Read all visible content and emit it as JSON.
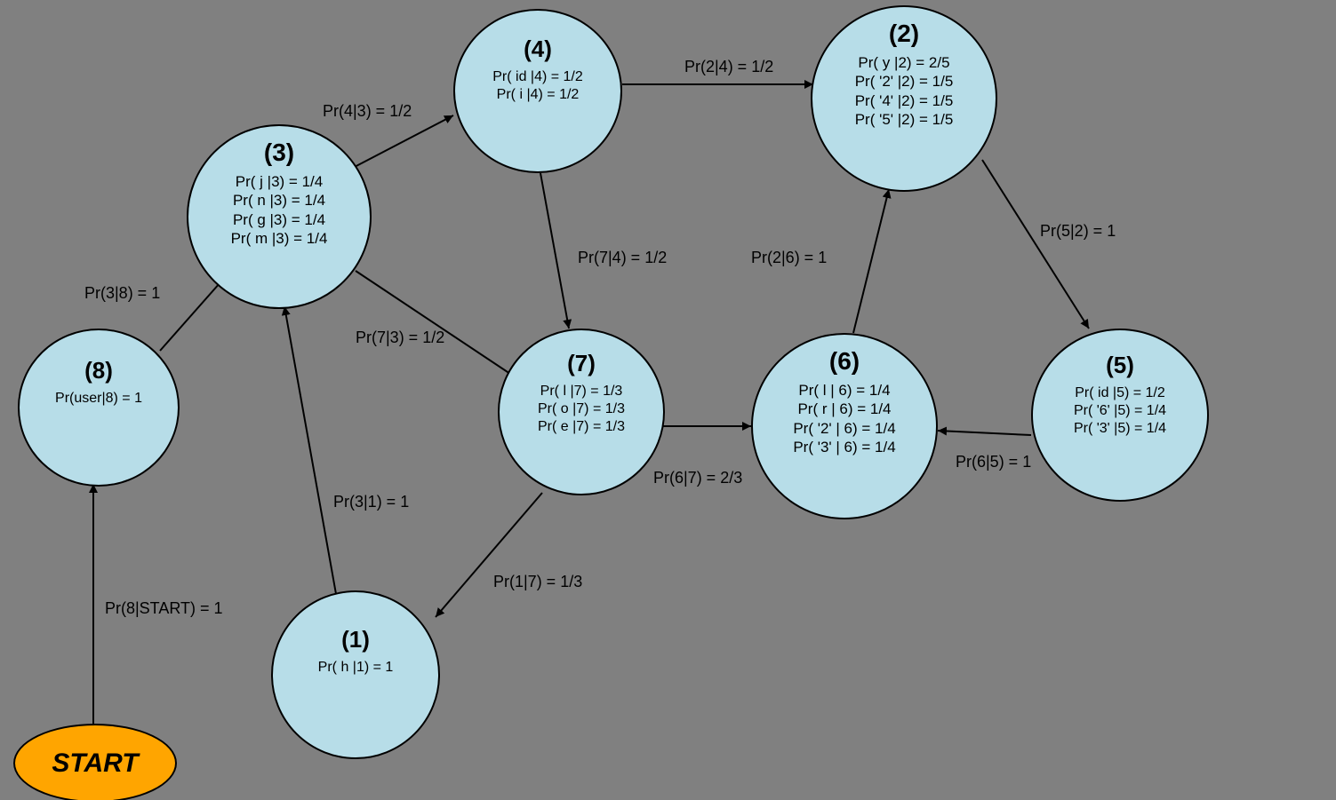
{
  "start": {
    "label": "START"
  },
  "nodes": {
    "n1": {
      "title": "(1)",
      "lines": "Pr( h |1) = 1"
    },
    "n2": {
      "title": "(2)",
      "lines": "Pr( y |2) = 2/5\nPr( '2' |2) = 1/5\nPr( '4' |2) = 1/5\nPr( '5' |2) = 1/5"
    },
    "n3": {
      "title": "(3)",
      "lines": "Pr( j |3) = 1/4\nPr( n |3) = 1/4\nPr( g |3) = 1/4\nPr( m |3) = 1/4"
    },
    "n4": {
      "title": "(4)",
      "lines": "Pr( id |4) = 1/2\nPr( i |4) = 1/2"
    },
    "n5": {
      "title": "(5)",
      "lines": "Pr( id |5) = 1/2\nPr( '6' |5) = 1/4\nPr( '3' |5) = 1/4"
    },
    "n6": {
      "title": "(6)",
      "lines": "Pr( l | 6) = 1/4\nPr( r | 6) = 1/4\nPr( '2' | 6) = 1/4\nPr( '3' | 6) = 1/4"
    },
    "n7": {
      "title": "(7)",
      "lines": "Pr( l |7) = 1/3\nPr( o |7) = 1/3\nPr( e |7) = 1/3"
    },
    "n8": {
      "title": "(8)",
      "lines": "Pr(user|8) = 1"
    }
  },
  "edges": {
    "e_start_8": "Pr(8|START) = 1",
    "e_8_3": "Pr(3|8) = 1",
    "e_3_4": "Pr(4|3) = 1/2",
    "e_3_7": "Pr(7|3) = 1/2",
    "e_4_2": "Pr(2|4) = 1/2",
    "e_4_7": "Pr(7|4) = 1/2",
    "e_7_6": "Pr(6|7) = 2/3",
    "e_7_1": "Pr(1|7) = 1/3",
    "e_1_3": "Pr(3|1) = 1",
    "e_6_2": "Pr(2|6) = 1",
    "e_2_5": "Pr(5|2) = 1",
    "e_5_6": "Pr(6|5) = 1"
  }
}
